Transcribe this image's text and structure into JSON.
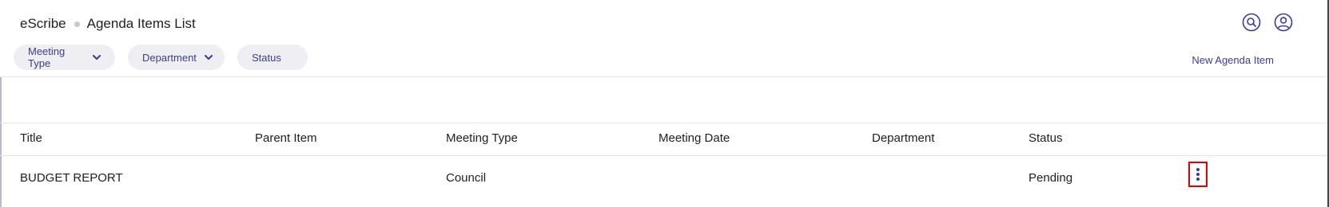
{
  "header": {
    "app_name": "eScribe",
    "page_title": "Agenda Items List"
  },
  "filters": [
    {
      "label": "Meeting Type"
    },
    {
      "label": "Department"
    },
    {
      "label": "Status"
    }
  ],
  "actions": {
    "new_item_label": "New Agenda Item"
  },
  "table": {
    "columns": [
      "Title",
      "Parent Item",
      "Meeting Type",
      "Meeting Date",
      "Department",
      "Status"
    ],
    "rows": [
      {
        "title": "BUDGET REPORT",
        "parent_item": "",
        "meeting_type": "Council",
        "meeting_date": "",
        "department": "",
        "status": "Pending"
      }
    ]
  },
  "colors": {
    "accent": "#3b3d8c",
    "pill_bg": "#eeeef3",
    "highlight": "#e00000"
  },
  "icons": [
    "search-icon",
    "user-profile-icon",
    "chevron-down-icon",
    "more-vertical-icon"
  ]
}
